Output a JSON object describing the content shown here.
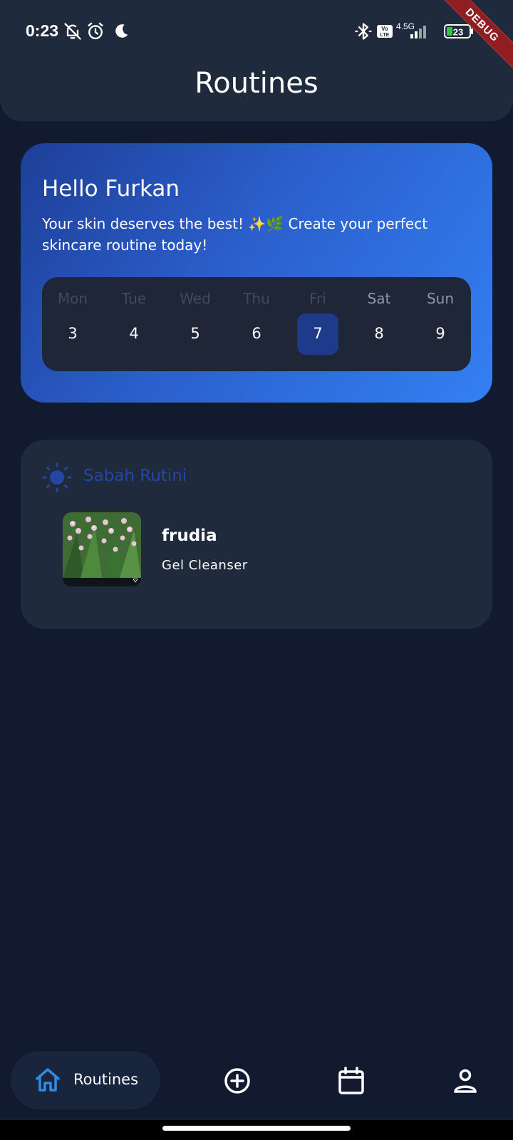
{
  "status_bar": {
    "time": "0:23",
    "network": "4.5G",
    "volte": "Vo LTE",
    "battery": "23",
    "icons": [
      "bell-off-icon",
      "alarm-icon",
      "moon-icon",
      "bluetooth-icon",
      "volte-icon",
      "signal-icon",
      "battery-icon"
    ]
  },
  "debug_banner": "DEBUG",
  "header": {
    "title": "Routines"
  },
  "greeting": {
    "title": "Hello Furkan",
    "subtitle": "Your skin deserves the best! ✨🌿 Create your perfect skincare routine today!"
  },
  "week": {
    "days": [
      {
        "name": "Mon",
        "num": "3",
        "selected": false,
        "name_color": "#3f4a5c"
      },
      {
        "name": "Tue",
        "num": "4",
        "selected": false,
        "name_color": "#3f4a5c"
      },
      {
        "name": "Wed",
        "num": "5",
        "selected": false,
        "name_color": "#3f4a5c"
      },
      {
        "name": "Thu",
        "num": "6",
        "selected": false,
        "name_color": "#3f4a5c"
      },
      {
        "name": "Fri",
        "num": "7",
        "selected": true,
        "name_color": "#3f4a5c"
      },
      {
        "name": "Sat",
        "num": "8",
        "selected": false,
        "name_color": "#8e97a6"
      },
      {
        "name": "Sun",
        "num": "9",
        "selected": false,
        "name_color": "#8e97a6"
      }
    ],
    "selected_color": "#1e3a8a"
  },
  "routine": {
    "title": "Sabah Rutini",
    "icon": "sun-icon",
    "accent": "#2446a6",
    "product": {
      "brand": "frudia",
      "name": "Gel Cleanser",
      "image": "product-thumbnail"
    }
  },
  "nav": {
    "active_label": "Routines",
    "items": [
      "home-icon",
      "add-circle-icon",
      "calendar-icon",
      "profile-icon"
    ],
    "active_color": "#2f8be6"
  }
}
